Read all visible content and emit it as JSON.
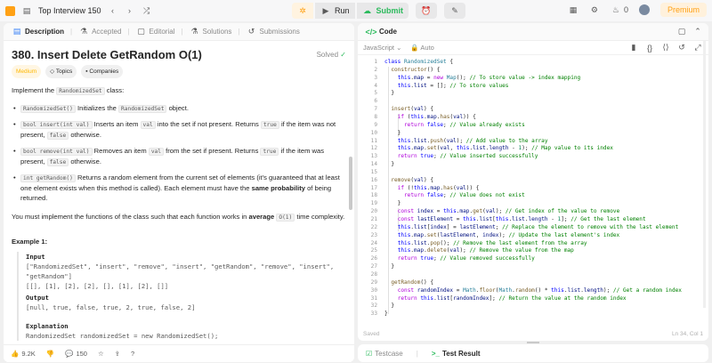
{
  "topbar": {
    "list_title": "Top Interview 150",
    "run_label": "Run",
    "submit_label": "Submit",
    "streak": "0",
    "premium_label": "Premium"
  },
  "description_tabs": [
    "Description",
    "Accepted",
    "Editorial",
    "Solutions",
    "Submissions"
  ],
  "problem": {
    "title": "380. Insert Delete GetRandom O(1)",
    "status": "Solved",
    "difficulty": "Medium",
    "tags": [
      "Topics",
      "Companies"
    ],
    "intro_prefix": "Implement the ",
    "intro_class": "RandomizedSet",
    "intro_suffix": " class:",
    "bullets": [
      {
        "code": "RandomizedSet()",
        "text": " Initializes the ",
        "code2": "RandomizedSet",
        "text2": " object."
      },
      {
        "code": "bool insert(int val)",
        "text": " Inserts an item ",
        "code2": "val",
        "text2": " into the set if not present. Returns ",
        "code3": "true",
        "text3": " if the item was not present, ",
        "code4": "false",
        "text4": " otherwise."
      },
      {
        "code": "bool remove(int val)",
        "text": " Removes an item ",
        "code2": "val",
        "text2": " from the set if present. Returns ",
        "code3": "true",
        "text3": " if the item was present, ",
        "code4": "false",
        "text4": " otherwise."
      },
      {
        "code": "int getRandom()",
        "text": " Returns a random element from the current set of elements (it's guaranteed that at least one element exists when this method is called). Each element must have the ",
        "bold": "same probability",
        "text2": " of being returned."
      }
    ],
    "complexity_prefix": "You must implement the functions of the class such that each function works in ",
    "complexity_bold": "average",
    "complexity_code": "O(1)",
    "complexity_suffix": " time complexity.",
    "example_title": "Example 1:",
    "input_label": "Input",
    "input_line1": "[\"RandomizedSet\", \"insert\", \"remove\", \"insert\", \"getRandom\", \"remove\", \"insert\",",
    "input_line2": "\"getRandom\"]",
    "input_line3": "[[], [1], [2], [2], [], [1], [2], []]",
    "output_label": "Output",
    "output_value": "[null, true, false, true, 2, true, false, 2]",
    "explanation_label": "Explanation",
    "explanation_line": "RandomizedSet randomizedSet = new RandomizedSet();"
  },
  "footer": {
    "likes": "9.2K",
    "comments": "150"
  },
  "code_panel": {
    "title": "Code",
    "language": "JavaScript",
    "mode": "Auto",
    "saved": "Saved",
    "cursor": "Ln 34, Col 1"
  },
  "code_lines": [
    "class RandomizedSet {",
    "  constructor() {",
    "    this.map = new Map(); // To store value -> index mapping",
    "    this.list = []; // To store values",
    "  }",
    "",
    "  insert(val) {",
    "    if (this.map.has(val)) {",
    "      return false; // Value already exists",
    "    }",
    "    this.list.push(val); // Add value to the array",
    "    this.map.set(val, this.list.length - 1); // Map value to its index",
    "    return true; // Value inserted successfully",
    "  }",
    "",
    "  remove(val) {",
    "    if (!this.map.has(val)) {",
    "      return false; // Value does not exist",
    "    }",
    "    const index = this.map.get(val); // Get index of the value to remove",
    "    const lastElement = this.list[this.list.length - 1]; // Get the last element",
    "    this.list[index] = lastElement; // Replace the element to remove with the last element",
    "    this.map.set(lastElement, index); // Update the last element's index",
    "    this.list.pop(); // Remove the last element from the array",
    "    this.map.delete(val); // Remove the value from the map",
    "    return true; // Value removed successfully",
    "  }",
    "",
    "  getRandom() {",
    "    const randomIndex = Math.floor(Math.random() * this.list.length); // Get a random index",
    "    return this.list[randomIndex]; // Return the value at the random index",
    "  }",
    "}"
  ],
  "tests_tabs": [
    "Testcase",
    "Test Result"
  ]
}
